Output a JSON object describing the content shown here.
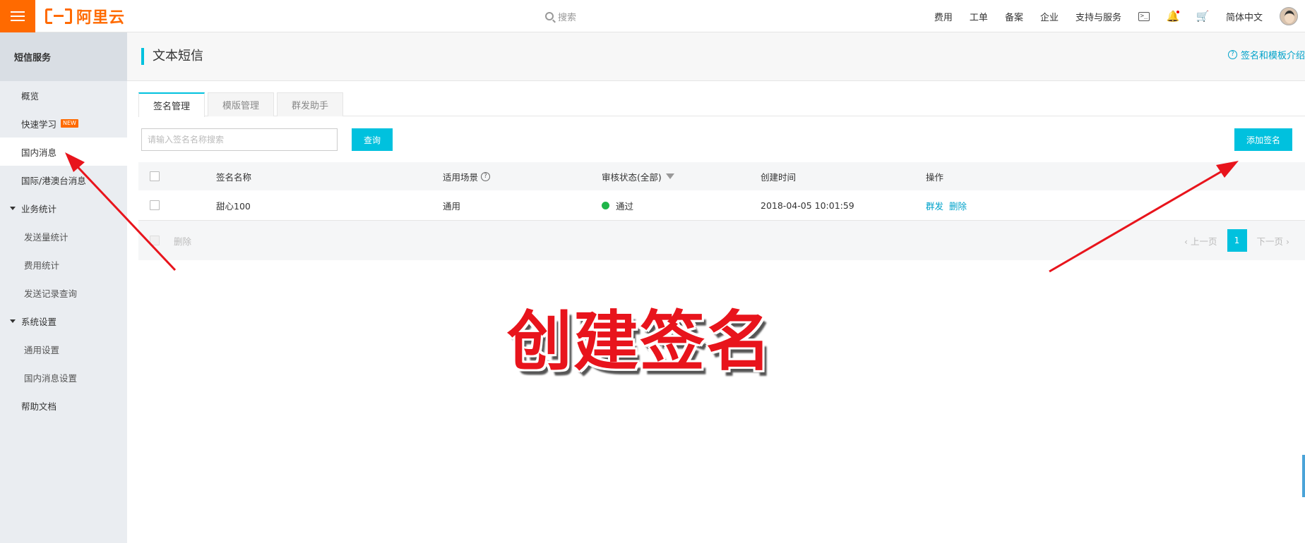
{
  "topbar": {
    "logo_text": "阿里云",
    "search_placeholder": "搜索",
    "nav": [
      "费用",
      "工单",
      "备案",
      "企业",
      "支持与服务"
    ],
    "language": "简体中文",
    "icons": [
      "terminal-icon",
      "bell-icon",
      "cart-icon"
    ]
  },
  "sidebar": {
    "title": "短信服务",
    "items": [
      {
        "label": "概览",
        "level": 1
      },
      {
        "label": "快速学习",
        "level": 1,
        "badge": "NEW"
      },
      {
        "label": "国内消息",
        "level": 1,
        "active": true
      },
      {
        "label": "国际/港澳台消息",
        "level": 1
      },
      {
        "label": "业务统计",
        "level": 0
      },
      {
        "label": "发送量统计",
        "level": 2
      },
      {
        "label": "费用统计",
        "level": 2
      },
      {
        "label": "发送记录查询",
        "level": 2
      },
      {
        "label": "系统设置",
        "level": 0
      },
      {
        "label": "通用设置",
        "level": 2
      },
      {
        "label": "国内消息设置",
        "level": 2
      },
      {
        "label": "帮助文档",
        "level": 1
      }
    ]
  },
  "page": {
    "title": "文本短信",
    "help_link": "签名和模板介绍",
    "tabs": [
      "签名管理",
      "模版管理",
      "群发助手"
    ],
    "search_placeholder": "请输入签名名称搜索",
    "query_button": "查询",
    "add_button": "添加签名"
  },
  "table": {
    "columns": [
      "签名名称",
      "适用场景",
      "审核状态(全部)",
      "创建时间",
      "操作"
    ],
    "rows": [
      {
        "name": "甜心100",
        "scene": "通用",
        "status": "通过",
        "created": "2018-04-05 10:01:59",
        "actions": [
          "群发",
          "删除"
        ]
      }
    ],
    "footer_delete": "删除",
    "pager": {
      "prev": "上一页",
      "current": "1",
      "next": "下一页"
    }
  },
  "annotation": {
    "overlay_text": "创建签名",
    "arrow_color": "#e8141c"
  },
  "colors": {
    "accent": "#00c1de",
    "brand": "#ff6a00",
    "success": "#1fb549"
  }
}
